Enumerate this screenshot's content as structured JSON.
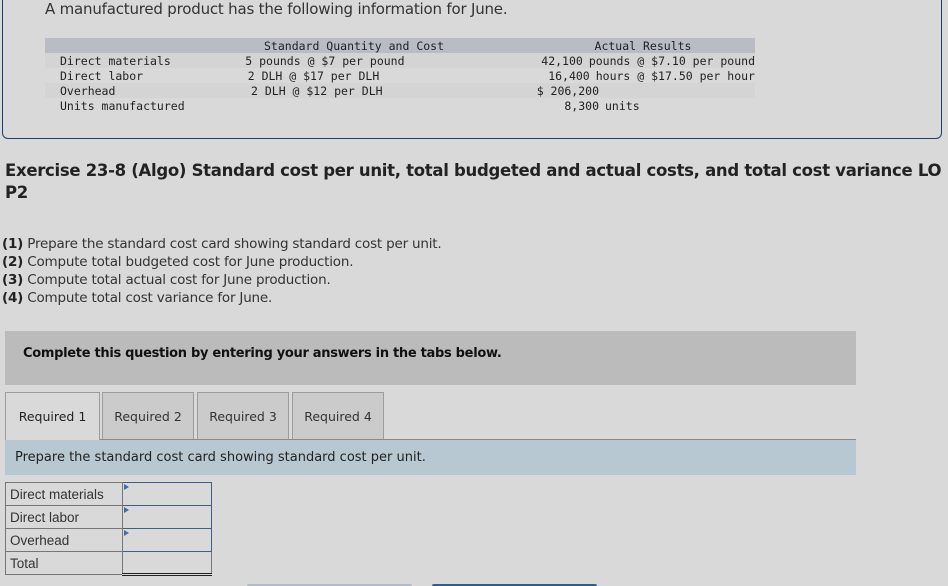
{
  "info": {
    "intro": "A manufactured product has the following information for June.",
    "headers": {
      "standard": "Standard Quantity and Cost",
      "actual": "Actual Results"
    },
    "rows": [
      {
        "label": "Direct materials",
        "standard": "5 pounds @ $7 per pound",
        "actual_num": "42,100",
        "actual_rest": "pounds @ $7.10 per pound"
      },
      {
        "label": "Direct labor",
        "standard": "2 DLH @ $17 per DLH",
        "actual_num": "16,400",
        "actual_rest": "hours @ $17.50 per hour"
      },
      {
        "label": "Overhead",
        "standard": "2 DLH @ $12 per DLH",
        "actual_num": "$ 206,200",
        "actual_rest": ""
      },
      {
        "label": "Units manufactured",
        "standard": "",
        "actual_num": "8,300",
        "actual_rest": "units"
      }
    ]
  },
  "exercise": {
    "title": "Exercise 23-8 (Algo) Standard cost per unit, total budgeted and actual costs, and total cost variance LO P2",
    "requirements": [
      {
        "num": "(1)",
        "text": "Prepare the standard cost card showing standard cost per unit."
      },
      {
        "num": "(2)",
        "text": "Compute total budgeted cost for June production."
      },
      {
        "num": "(3)",
        "text": "Compute total actual cost for June production."
      },
      {
        "num": "(4)",
        "text": "Compute total cost variance for June."
      }
    ]
  },
  "instructions": "Complete this question by entering your answers in the tabs below.",
  "tabs": [
    {
      "label": "Required 1",
      "active": true
    },
    {
      "label": "Required 2",
      "active": false
    },
    {
      "label": "Required 3",
      "active": false
    },
    {
      "label": "Required 4",
      "active": false
    }
  ],
  "panel": {
    "header": "Prepare the standard cost card showing standard cost per unit.",
    "cost_card": [
      {
        "label": "Direct materials",
        "value": ""
      },
      {
        "label": "Direct labor",
        "value": ""
      },
      {
        "label": "Overhead",
        "value": ""
      },
      {
        "label": "Total",
        "value": ""
      }
    ]
  },
  "colors": {
    "box_border": "#1f3f6e",
    "panel_header_bg": "#b8c8d2",
    "input_border": "#3d5f8c",
    "next_button": "#2e5d93"
  }
}
